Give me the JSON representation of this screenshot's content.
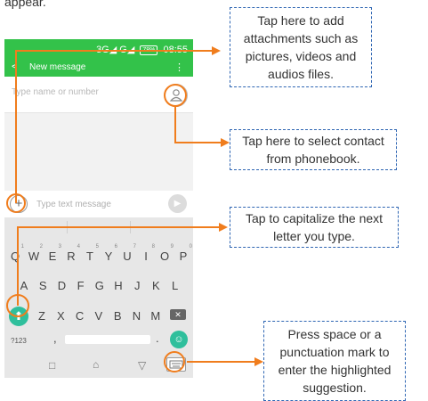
{
  "intro": {
    "text": "appear."
  },
  "status_bar": {
    "network": "3G◢ G◢",
    "battery": "78%",
    "time": "08:55"
  },
  "app_bar": {
    "back_icon": "arrow-left-icon",
    "title": "New message",
    "menu_icon": "overflow-menu-icon"
  },
  "recipient": {
    "placeholder": "Type name or number",
    "contact_icon": "person-icon"
  },
  "compose": {
    "add_icon": "plus-icon",
    "placeholder": "Type text message",
    "send_icon": "send-icon"
  },
  "keyboard": {
    "row1": [
      {
        "key": "Q",
        "alt": "1"
      },
      {
        "key": "W",
        "alt": "2"
      },
      {
        "key": "E",
        "alt": "3"
      },
      {
        "key": "R",
        "alt": "4"
      },
      {
        "key": "T",
        "alt": "5"
      },
      {
        "key": "Y",
        "alt": "6"
      },
      {
        "key": "U",
        "alt": "7"
      },
      {
        "key": "I",
        "alt": "8"
      },
      {
        "key": "O",
        "alt": "9"
      },
      {
        "key": "P",
        "alt": "0"
      }
    ],
    "row2": [
      "A",
      "S",
      "D",
      "F",
      "G",
      "H",
      "J",
      "K",
      "L"
    ],
    "row3": [
      "Z",
      "X",
      "C",
      "V",
      "B",
      "N",
      "M"
    ],
    "symbols_label": "?123",
    "comma": ",",
    "period": ".",
    "shift_icon": "shift-arrow-icon",
    "backspace_icon": "backspace-icon",
    "emoji_icon": "emoji-icon"
  },
  "nav_bar": {
    "recents": "□",
    "home": "⌂",
    "back": "▽"
  },
  "callouts": {
    "attachments": "Tap here to add attachments such as pictures, videos and audios files.",
    "contact": "Tap here to select contact from phonebook.",
    "capitalize": "Tap to capitalize the next letter you type.",
    "space": "Press space or a punctuation mark to enter the highlighted suggestion."
  },
  "colors": {
    "accent_green": "#33c24a",
    "teal": "#2fbf9c",
    "line_orange": "#f07d1d",
    "dash_blue": "#2f66b3"
  }
}
